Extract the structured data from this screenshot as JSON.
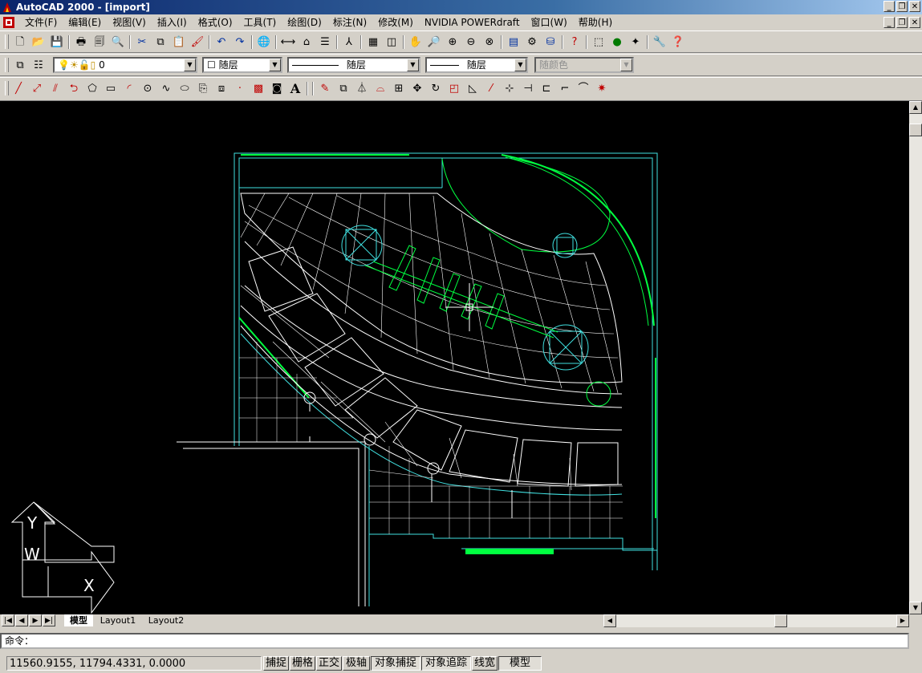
{
  "window": {
    "title": "AutoCAD 2000 - [import]",
    "controls": [
      "_",
      "❐",
      "✕"
    ]
  },
  "menubar": {
    "items": [
      {
        "label": "文件(F)"
      },
      {
        "label": "编辑(E)"
      },
      {
        "label": "视图(V)"
      },
      {
        "label": "插入(I)"
      },
      {
        "label": "格式(O)"
      },
      {
        "label": "工具(T)"
      },
      {
        "label": "绘图(D)"
      },
      {
        "label": "标注(N)"
      },
      {
        "label": "修改(M)"
      },
      {
        "label": "NVIDIA POWERdraft"
      },
      {
        "label": "窗口(W)"
      },
      {
        "label": "帮助(H)"
      }
    ]
  },
  "layer_bar": {
    "layer_value": "0",
    "color_value": "随层",
    "linetype_value": "随层",
    "lineweight_value": "随层",
    "plotstyle_value": "随颜色"
  },
  "ucs": {
    "x_label": "X",
    "y_label": "Y",
    "w_label": "W"
  },
  "tabs": [
    {
      "label": "模型",
      "active": true
    },
    {
      "label": "Layout1",
      "active": false
    },
    {
      "label": "Layout2",
      "active": false
    }
  ],
  "command_line": {
    "prompt": "命令："
  },
  "status": {
    "coordinates": "11560.9155, 11794.4331, 0.0000",
    "toggles": [
      {
        "label": "捕捉",
        "on": false
      },
      {
        "label": "栅格",
        "on": false
      },
      {
        "label": "正交",
        "on": false
      },
      {
        "label": "极轴",
        "on": false
      },
      {
        "label": "对象捕捉",
        "on": true
      },
      {
        "label": "对象追踪",
        "on": true
      },
      {
        "label": "线宽",
        "on": false
      },
      {
        "label": "模型",
        "on": true
      }
    ]
  },
  "colors": {
    "canvas_bg": "#000000",
    "cyan_line": "#40e0e0",
    "green_line": "#00ff40",
    "white_line": "#ffffff",
    "title_bar": "#0a246a"
  }
}
